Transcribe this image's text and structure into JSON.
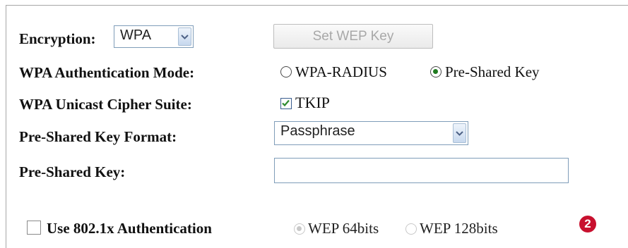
{
  "encryption": {
    "label": "Encryption:",
    "selected": "WPA",
    "set_wep_key_label": "Set WEP Key"
  },
  "auth_mode": {
    "label": "WPA Authentication Mode:",
    "options": [
      {
        "label": "WPA-RADIUS",
        "checked": false
      },
      {
        "label": "Pre-Shared Key",
        "checked": true
      }
    ]
  },
  "cipher": {
    "label": "WPA Unicast Cipher Suite:",
    "option_label": "TKIP",
    "checked": true
  },
  "key_format": {
    "label": "Pre-Shared Key Format:",
    "selected": "Passphrase"
  },
  "psk": {
    "label": "Pre-Shared Key:",
    "value": ""
  },
  "auth_8021x": {
    "label": "Use 802.1x Authentication",
    "checked": false,
    "wep_options": [
      {
        "label": "WEP 64bits",
        "checked": true,
        "enabled": false
      },
      {
        "label": "WEP 128bits",
        "checked": false,
        "enabled": false
      }
    ]
  },
  "step_badge": "2",
  "colors": {
    "badge": "#c8102e",
    "radio_dot": "#1f7a1f",
    "checkbox_check": "#2e8b2e"
  }
}
